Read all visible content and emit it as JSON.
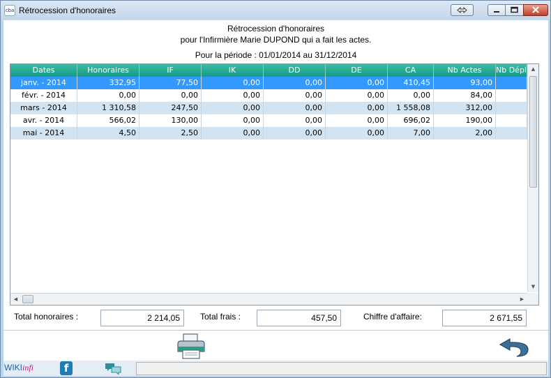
{
  "window": {
    "title": "Rétrocession d'honoraires",
    "app_icon": "cba",
    "controls": [
      "swap-icon",
      "minimize-icon",
      "maximize-icon",
      "close-icon"
    ]
  },
  "header": {
    "line1": "Rétrocession d'honoraires",
    "line2": "pour l'Infirmière Marie DUPOND qui a fait les actes.",
    "period": "Pour la période  :  01/01/2014 au 31/12/2014"
  },
  "table": {
    "columns": [
      "Dates",
      "Honoraires",
      "IF",
      "IK",
      "DD",
      "DE",
      "CA",
      "Nb Actes",
      "Nb Dépl."
    ],
    "rows": [
      [
        "janv. - 2014",
        "332,95",
        "77,50",
        "0,00",
        "0,00",
        "0,00",
        "410,45",
        "93,00",
        ""
      ],
      [
        "févr. - 2014",
        "0,00",
        "0,00",
        "0,00",
        "0,00",
        "0,00",
        "0,00",
        "84,00",
        ""
      ],
      [
        "mars - 2014",
        "1 310,58",
        "247,50",
        "0,00",
        "0,00",
        "0,00",
        "1 558,08",
        "312,00",
        ""
      ],
      [
        "avr. - 2014",
        "566,02",
        "130,00",
        "0,00",
        "0,00",
        "0,00",
        "696,02",
        "190,00",
        ""
      ],
      [
        "mai - 2014",
        "4,50",
        "2,50",
        "0,00",
        "0,00",
        "0,00",
        "7,00",
        "2,00",
        ""
      ]
    ],
    "selected_row": 0
  },
  "totals": {
    "honoraires_label": "Total honoraires :",
    "honoraires_value": "2 214,05",
    "frais_label": "Total frais :",
    "frais_value": "457,50",
    "ca_label": "Chiffre d'affaire:",
    "ca_value": "2 671,55"
  },
  "footer": {
    "wiki_w": "WIKI",
    "wiki_i": "infi",
    "facebook": "f",
    "print_icon": "printer-icon",
    "back_icon": "back-arrow-icon",
    "chat_icon": "chat-icon"
  },
  "colors": {
    "header_teal": "#129a85",
    "selected_row": "#3399ff",
    "alt_row": "#d2e4f2"
  }
}
